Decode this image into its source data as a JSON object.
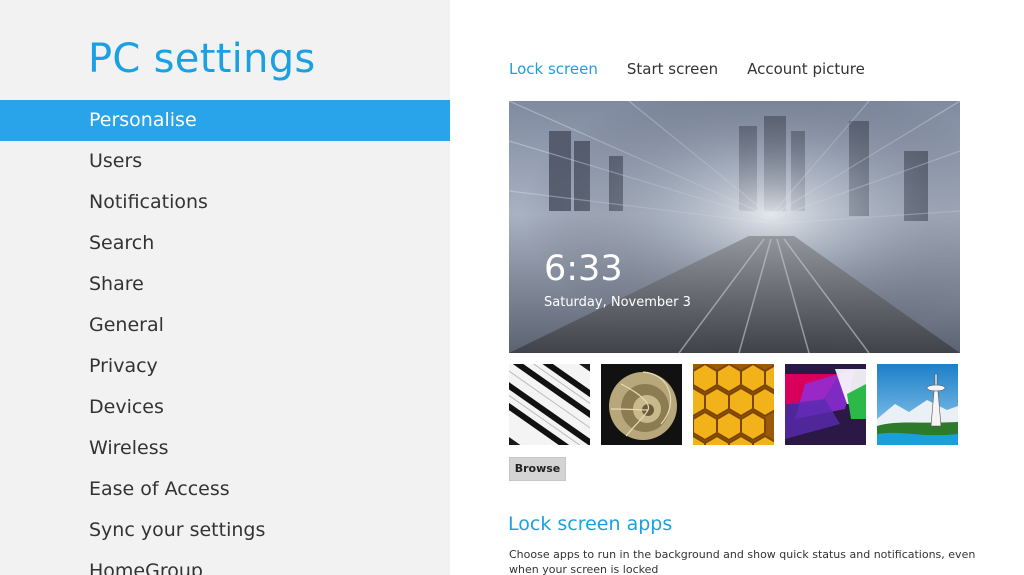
{
  "app": {
    "title": "PC settings"
  },
  "nav": {
    "items": [
      {
        "label": "Personalise",
        "selected": true
      },
      {
        "label": "Users"
      },
      {
        "label": "Notifications"
      },
      {
        "label": "Search"
      },
      {
        "label": "Share"
      },
      {
        "label": "General"
      },
      {
        "label": "Privacy"
      },
      {
        "label": "Devices"
      },
      {
        "label": "Wireless"
      },
      {
        "label": "Ease of Access"
      },
      {
        "label": "Sync your settings"
      },
      {
        "label": "HomeGroup"
      }
    ]
  },
  "tabs": [
    {
      "label": "Lock screen",
      "active": true
    },
    {
      "label": "Start screen"
    },
    {
      "label": "Account picture"
    }
  ],
  "lock_preview": {
    "time": "6:33",
    "date": "Saturday, November 3"
  },
  "thumbnails": [
    {
      "name": "piano-keys"
    },
    {
      "name": "nautilus-shell"
    },
    {
      "name": "honeycomb"
    },
    {
      "name": "abstract-shapes"
    },
    {
      "name": "space-needle"
    }
  ],
  "browse_label": "Browse",
  "lock_apps": {
    "title": "Lock screen apps",
    "description": "Choose apps to run in the background and show quick status and notifications, even when your screen is locked"
  },
  "colors": {
    "accent": "#1ba1e2",
    "selected": "#29a4eb",
    "left_bg": "#f2f2f2"
  }
}
